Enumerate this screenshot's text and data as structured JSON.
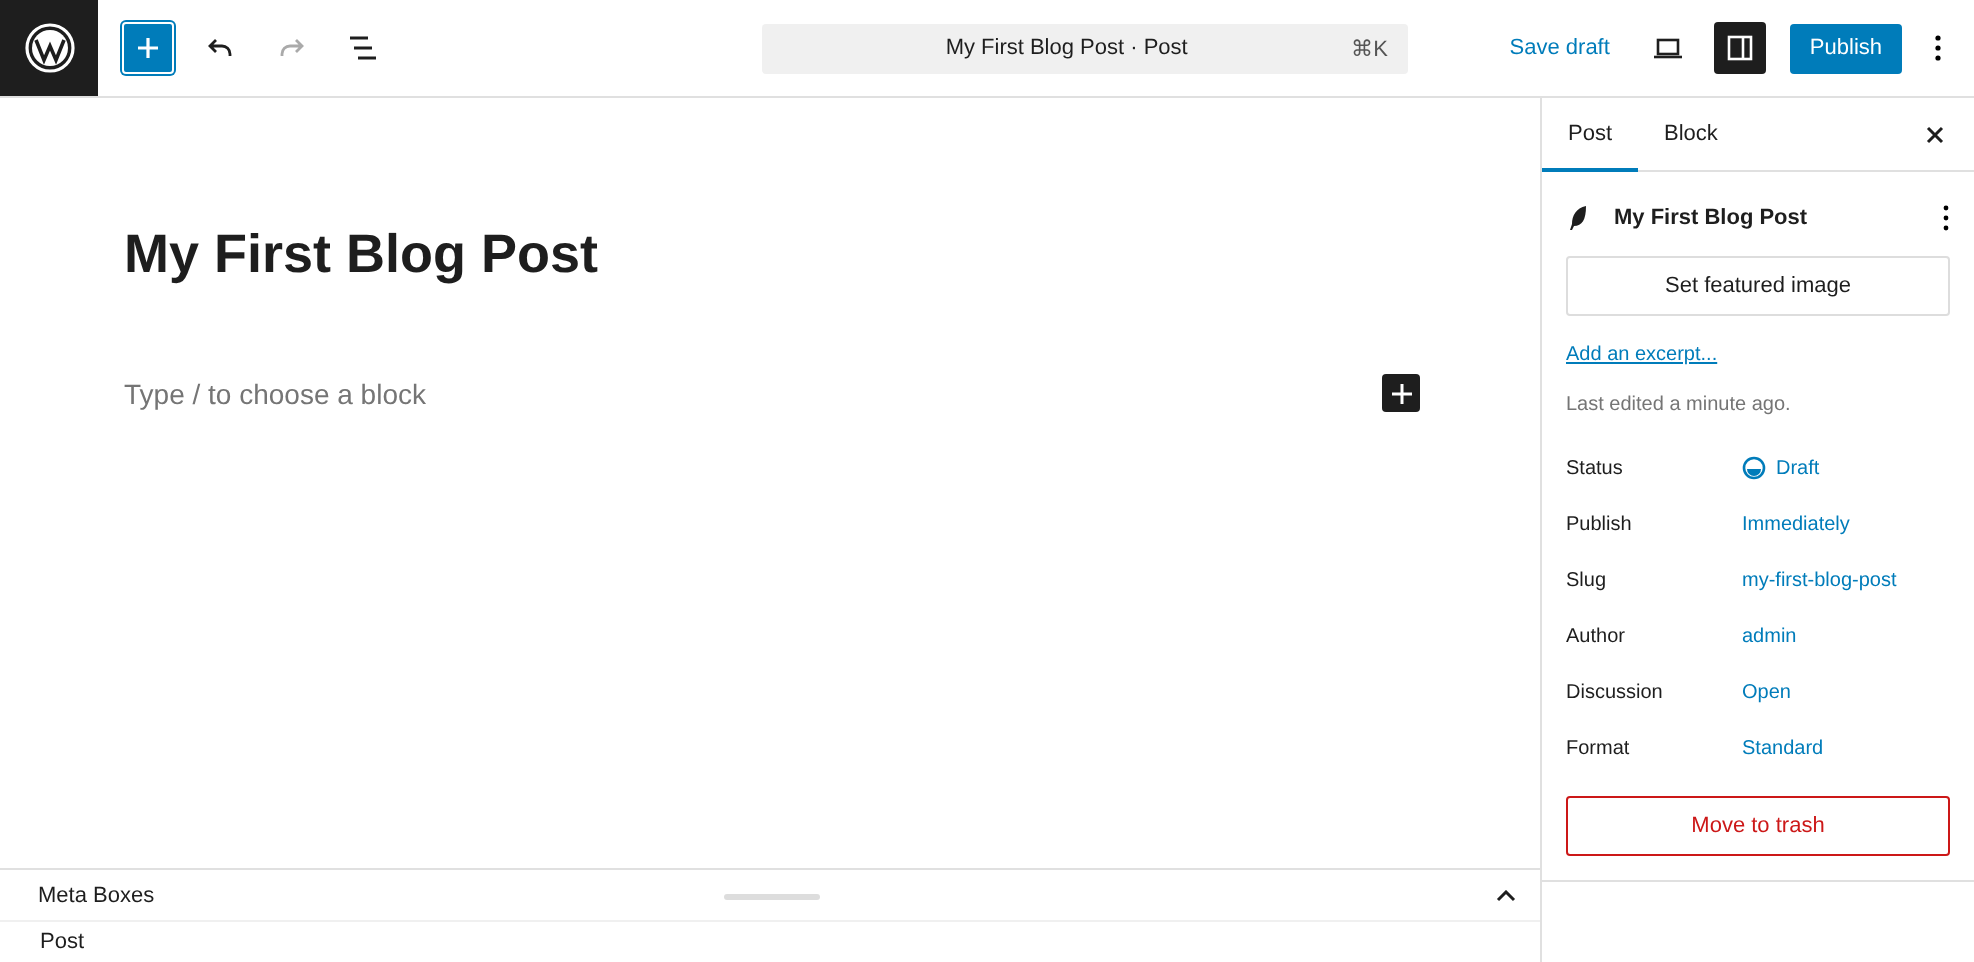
{
  "toolbar": {
    "command_bar": {
      "title": "My First Blog Post · Post",
      "shortcut": "⌘K"
    },
    "save_draft": "Save draft",
    "settings_open": true,
    "publish": "Publish"
  },
  "editor": {
    "title": "My First Blog Post",
    "placeholder": "Type / to choose a block"
  },
  "meta_boxes": {
    "title": "Meta Boxes",
    "expanded": true,
    "items": [
      "Post"
    ]
  },
  "sidebar": {
    "tabs": [
      {
        "label": "Post",
        "selected": true
      },
      {
        "label": "Block",
        "selected": false
      }
    ],
    "post_title": "My First Blog Post",
    "featured_image_button": "Set featured image",
    "excerpt_link": "Add an excerpt...",
    "last_edited": "Last edited a minute ago.",
    "fields": [
      {
        "label": "Status",
        "value": "Draft",
        "kind": "status"
      },
      {
        "label": "Publish",
        "value": "Immediately",
        "kind": "link"
      },
      {
        "label": "Slug",
        "value": "my-first-blog-post",
        "kind": "link"
      },
      {
        "label": "Author",
        "value": "admin",
        "kind": "link"
      },
      {
        "label": "Discussion",
        "value": "Open",
        "kind": "link"
      },
      {
        "label": "Format",
        "value": "Standard",
        "kind": "link"
      }
    ],
    "trash_button": "Move to trash"
  }
}
